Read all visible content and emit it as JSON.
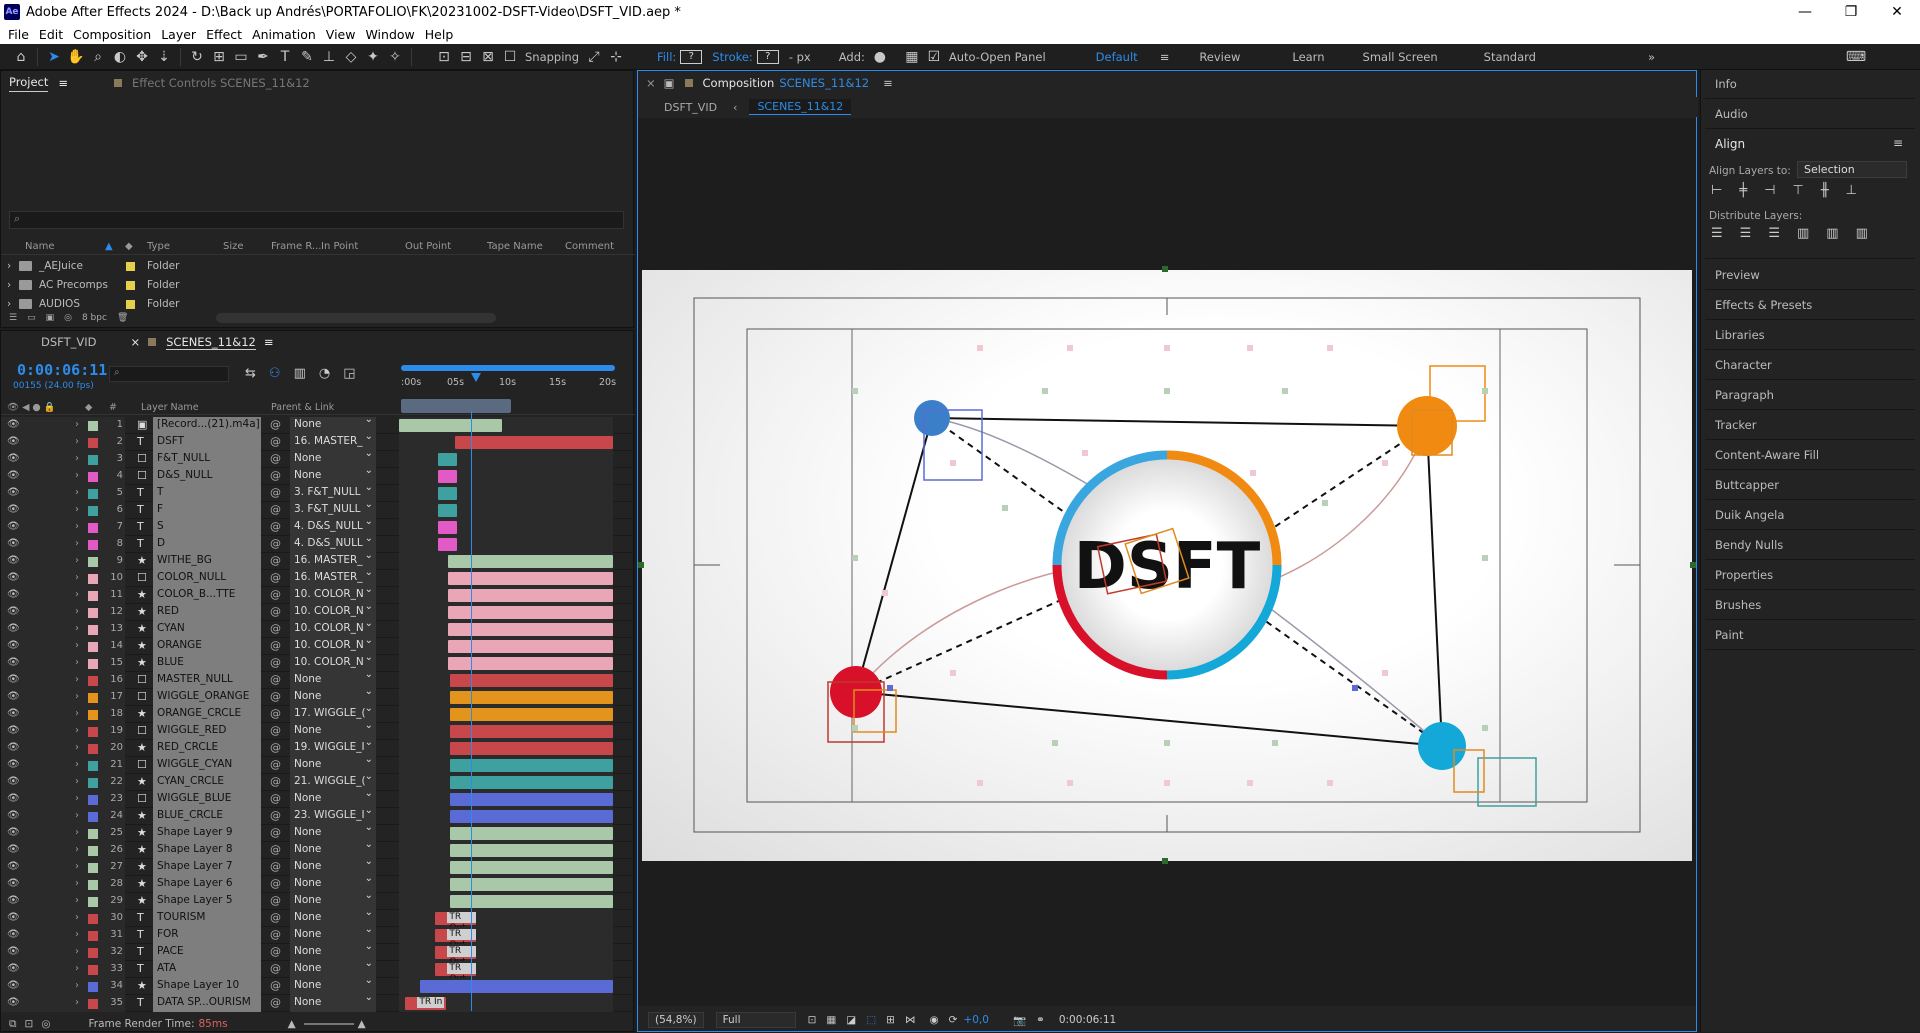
{
  "window": {
    "app_badge": "Ae",
    "title": "Adobe After Effects 2024 - D:\\Back up Andrés\\PORTAFOLIO\\FK\\20231002-DSFT-Video\\DSFT_VID.aep *",
    "minimize": "—",
    "maximize": "❐",
    "close": "✕"
  },
  "menu": [
    "File",
    "Edit",
    "Composition",
    "Layer",
    "Effect",
    "Animation",
    "View",
    "Window",
    "Help"
  ],
  "toolbar": {
    "snapping": "Snapping",
    "fill": "Fill:",
    "stroke": "Stroke:",
    "px": "- px",
    "add": "Add:",
    "auto_open": "Auto-Open Panel",
    "fill_value": "?",
    "stroke_value": "?",
    "workspaces": [
      "Default",
      "Review",
      "Learn",
      "Small Screen",
      "Standard"
    ],
    "active_workspace": "Default"
  },
  "project": {
    "tabs": [
      "Project",
      "Effect Controls SCENES_11&12"
    ],
    "search_placeholder": "⌕",
    "columns": [
      "Name",
      "Type",
      "Size",
      "Frame R...",
      "In Point",
      "Out Point",
      "Tape Name",
      "Comment"
    ],
    "rows": [
      {
        "name": "_AEJuice",
        "type": "Folder"
      },
      {
        "name": "AC Precomps",
        "type": "Folder"
      },
      {
        "name": "AUDIOS",
        "type": "Folder"
      }
    ],
    "bpc": "8 bpc"
  },
  "timeline": {
    "tabs": [
      "DSFT_VID",
      "SCENES_11&12"
    ],
    "timecode": "0:00:06:11",
    "timecode_sub": "00155 (24.00 fps)",
    "ruler": [
      ":00s",
      "05s",
      "10s",
      "15s",
      "20s"
    ],
    "col_layer_name": "Layer Name",
    "col_parent": "Parent & Link",
    "footer": "Frame Render Time:",
    "render_time": "85ms",
    "layers": [
      {
        "n": "1",
        "icon": "▣",
        "name": "[Record...(21).m4a]",
        "parent": "None",
        "color": "#a8c8a8",
        "clip": [
          0,
          48
        ]
      },
      {
        "n": "2",
        "icon": "T",
        "name": "DSFT",
        "parent": "16. MASTER_",
        "color": "#c8474a",
        "clip": [
          26,
          100
        ]
      },
      {
        "n": "3",
        "icon": "☐",
        "name": "F&T_NULL",
        "parent": "None",
        "color": "#3fa0a0",
        "clip": [
          18,
          27
        ]
      },
      {
        "n": "4",
        "icon": "☐",
        "name": "D&S_NULL",
        "parent": "None",
        "color": "#e25ac6",
        "clip": [
          18,
          27
        ]
      },
      {
        "n": "5",
        "icon": "T",
        "name": "T",
        "parent": "3. F&T_NULL",
        "color": "#3fa0a0",
        "clip": [
          18,
          27
        ]
      },
      {
        "n": "6",
        "icon": "T",
        "name": "F",
        "parent": "3. F&T_NULL",
        "color": "#3fa0a0",
        "clip": [
          18,
          27
        ]
      },
      {
        "n": "7",
        "icon": "T",
        "name": "S",
        "parent": "4. D&S_NULL",
        "color": "#e25ac6",
        "clip": [
          18,
          27
        ]
      },
      {
        "n": "8",
        "icon": "T",
        "name": "D",
        "parent": "4. D&S_NULL",
        "color": "#e25ac6",
        "clip": [
          18,
          27
        ]
      },
      {
        "n": "9",
        "icon": "★",
        "name": "WITHE_BG",
        "parent": "16. MASTER_",
        "color": "#a8c8a8",
        "clip": [
          23,
          100
        ]
      },
      {
        "n": "10",
        "icon": "☐",
        "name": "COLOR_NULL",
        "parent": "16. MASTER_",
        "color": "#e8a6b6",
        "clip": [
          23,
          100
        ]
      },
      {
        "n": "11",
        "icon": "★",
        "name": "COLOR_B...TTE",
        "parent": "10. COLOR_N",
        "color": "#e8a6b6",
        "clip": [
          23,
          100
        ]
      },
      {
        "n": "12",
        "icon": "★",
        "name": "RED",
        "parent": "10. COLOR_N",
        "color": "#e8a6b6",
        "clip": [
          23,
          100
        ]
      },
      {
        "n": "13",
        "icon": "★",
        "name": "CYAN",
        "parent": "10. COLOR_N",
        "color": "#e8a6b6",
        "clip": [
          23,
          100
        ]
      },
      {
        "n": "14",
        "icon": "★",
        "name": "ORANGE",
        "parent": "10. COLOR_N",
        "color": "#e8a6b6",
        "clip": [
          23,
          100
        ]
      },
      {
        "n": "15",
        "icon": "★",
        "name": "BLUE",
        "parent": "10. COLOR_N",
        "color": "#e8a6b6",
        "clip": [
          23,
          100
        ]
      },
      {
        "n": "16",
        "icon": "☐",
        "name": "MASTER_NULL",
        "parent": "None",
        "color": "#c8474a",
        "clip": [
          24,
          100
        ]
      },
      {
        "n": "17",
        "icon": "☐",
        "name": "WIGGLE_ORANGE",
        "parent": "None",
        "color": "#e3941c",
        "clip": [
          24,
          100
        ]
      },
      {
        "n": "18",
        "icon": "★",
        "name": "ORANGE_CRCLE",
        "parent": "17. WIGGLE_(",
        "color": "#e3941c",
        "clip": [
          24,
          100
        ]
      },
      {
        "n": "19",
        "icon": "☐",
        "name": "WIGGLE_RED",
        "parent": "None",
        "color": "#c8474a",
        "clip": [
          24,
          100
        ]
      },
      {
        "n": "20",
        "icon": "★",
        "name": "RED_CRCLE",
        "parent": "19. WIGGLE_I",
        "color": "#c8474a",
        "clip": [
          24,
          100
        ]
      },
      {
        "n": "21",
        "icon": "☐",
        "name": "WIGGLE_CYAN",
        "parent": "None",
        "color": "#3fa0a0",
        "clip": [
          24,
          100
        ]
      },
      {
        "n": "22",
        "icon": "★",
        "name": "CYAN_CRCLE",
        "parent": "21. WIGGLE_(",
        "color": "#3fa0a0",
        "clip": [
          24,
          100
        ]
      },
      {
        "n": "23",
        "icon": "☐",
        "name": "WIGGLE_BLUE",
        "parent": "None",
        "color": "#5a6bd6",
        "clip": [
          24,
          100
        ]
      },
      {
        "n": "24",
        "icon": "★",
        "name": "BLUE_CRCLE",
        "parent": "23. WIGGLE_I",
        "color": "#5a6bd6",
        "clip": [
          24,
          100
        ]
      },
      {
        "n": "25",
        "icon": "★",
        "name": "Shape Layer 9",
        "parent": "None",
        "color": "#a8c8a8",
        "clip": [
          24,
          100
        ]
      },
      {
        "n": "26",
        "icon": "★",
        "name": "Shape Layer 8",
        "parent": "None",
        "color": "#a8c8a8",
        "clip": [
          24,
          100
        ]
      },
      {
        "n": "27",
        "icon": "★",
        "name": "Shape Layer 7",
        "parent": "None",
        "color": "#a8c8a8",
        "clip": [
          24,
          100
        ]
      },
      {
        "n": "28",
        "icon": "★",
        "name": "Shape Layer 6",
        "parent": "None",
        "color": "#a8c8a8",
        "clip": [
          24,
          100
        ]
      },
      {
        "n": "29",
        "icon": "★",
        "name": "Shape Layer 5",
        "parent": "None",
        "color": "#a8c8a8",
        "clip": [
          24,
          100
        ]
      },
      {
        "n": "30",
        "icon": "T",
        "name": "TOURISM",
        "parent": "None",
        "color": "#c8474a",
        "clip": [
          17,
          36
        ],
        "ctext": "TR Out"
      },
      {
        "n": "31",
        "icon": "T",
        "name": "FOR",
        "parent": "None",
        "color": "#c8474a",
        "clip": [
          17,
          36
        ],
        "ctext": "TR Out"
      },
      {
        "n": "32",
        "icon": "T",
        "name": "PACE",
        "parent": "None",
        "color": "#c8474a",
        "clip": [
          17,
          36
        ],
        "ctext": "TR Out"
      },
      {
        "n": "33",
        "icon": "T",
        "name": "ATA",
        "parent": "None",
        "color": "#c8474a",
        "clip": [
          17,
          36
        ],
        "ctext": "TR Out"
      },
      {
        "n": "34",
        "icon": "★",
        "name": "Shape Layer 10",
        "parent": "None",
        "color": "#5a6bd6",
        "clip": [
          10,
          100
        ]
      },
      {
        "n": "35",
        "icon": "T",
        "name": "DATA SP...OURISM",
        "parent": "None",
        "color": "#c8474a",
        "clip": [
          3,
          22
        ],
        "ctext": "TR In"
      }
    ]
  },
  "composition": {
    "tab_label": "Composition",
    "tab_comp": "SCENES_11&12",
    "breadcrumb": [
      "DSFT_VID",
      "SCENES_11&12"
    ],
    "logo_text": "DSFT",
    "zoom": "(54,8%)",
    "resolution": "Full",
    "exposure": "+0,0",
    "current_time": "0:00:06:11",
    "colors": {
      "red": "#d8102a",
      "orange": "#f08a10",
      "cyan": "#14a8d8",
      "blue": "#3a8ad0"
    }
  },
  "right_panel": {
    "items_top": [
      "Info",
      "Audio"
    ],
    "align": {
      "title": "Align",
      "align_to_label": "Align Layers to:",
      "align_to_value": "Selection",
      "distribute_label": "Distribute Layers:"
    },
    "items": [
      "Preview",
      "Effects & Presets",
      "Libraries",
      "Character",
      "Paragraph",
      "Tracker",
      "Content-Aware Fill",
      "Buttcapper",
      "Duik Angela",
      "Bendy Nulls",
      "Properties",
      "Brushes",
      "Paint"
    ]
  }
}
